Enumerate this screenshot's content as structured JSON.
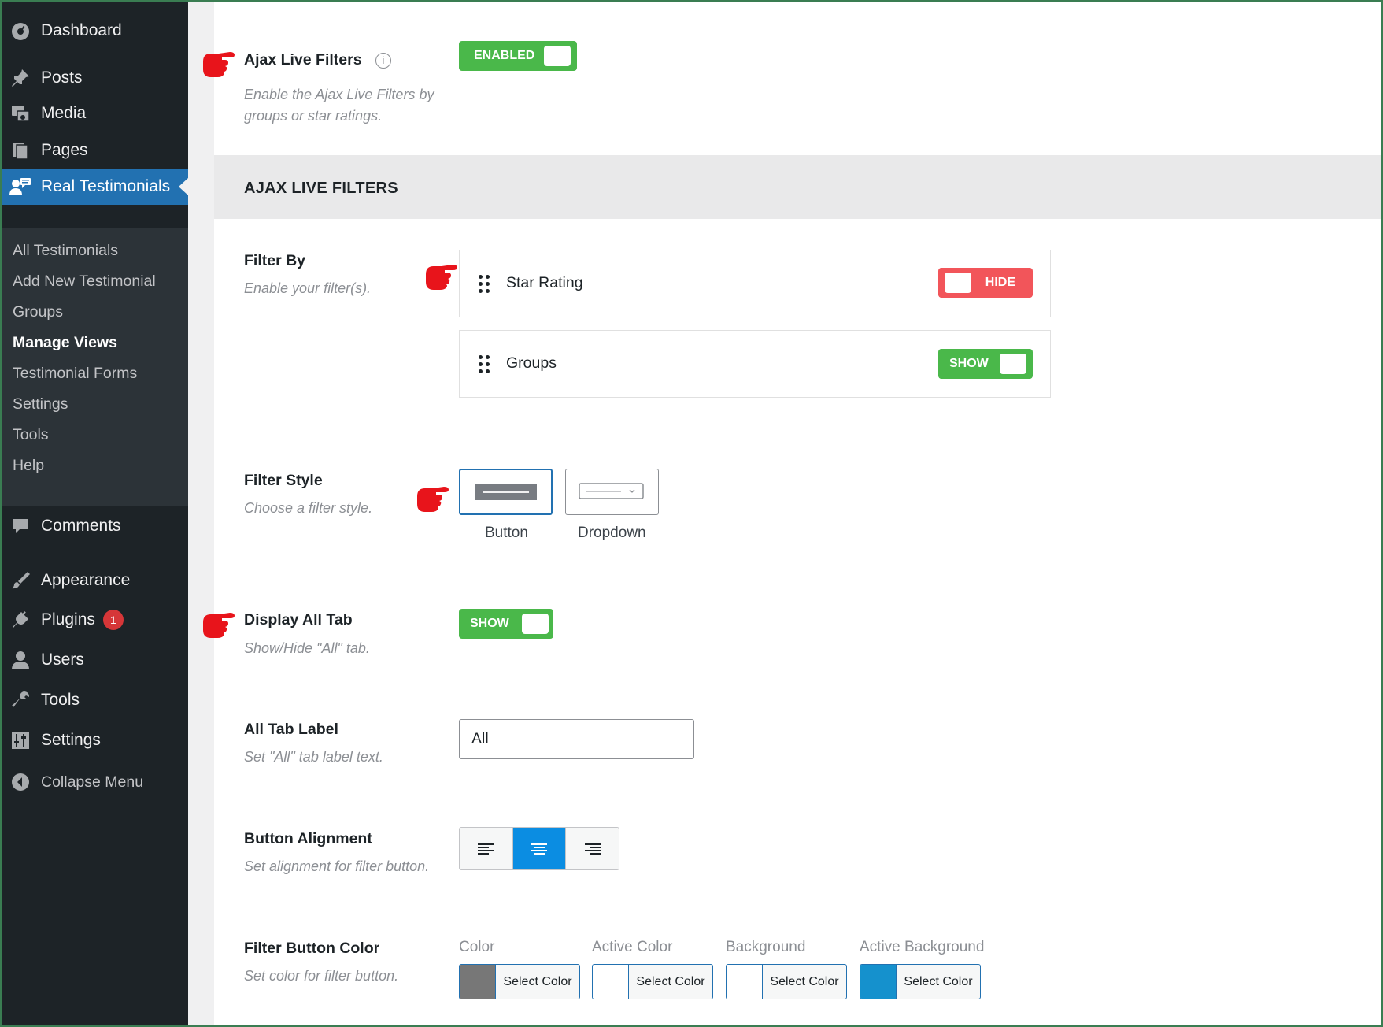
{
  "sidebar": {
    "menu": [
      {
        "label": "Dashboard",
        "icon": "dashboard-icon"
      },
      {
        "label": "Posts",
        "icon": "pin-icon"
      },
      {
        "label": "Media",
        "icon": "media-icon"
      },
      {
        "label": "Pages",
        "icon": "pages-icon"
      },
      {
        "label": "Real Testimonials",
        "icon": "testimonials-icon"
      },
      {
        "label": "Comments",
        "icon": "comment-icon"
      },
      {
        "label": "Appearance",
        "icon": "brush-icon"
      },
      {
        "label": "Plugins",
        "icon": "plugin-icon",
        "badge": "1"
      },
      {
        "label": "Users",
        "icon": "user-icon"
      },
      {
        "label": "Tools",
        "icon": "wrench-icon"
      },
      {
        "label": "Settings",
        "icon": "settings-icon"
      },
      {
        "label": "Collapse Menu",
        "icon": "collapse-icon"
      }
    ],
    "submenu": [
      "All Testimonials",
      "Add New Testimonial",
      "Groups",
      "Manage Views",
      "Testimonial Forms",
      "Settings",
      "Tools",
      "Help"
    ],
    "current_submenu": "Manage Views",
    "active_color": "#2271b1"
  },
  "ajax_filters": {
    "label": "Ajax Live Filters",
    "info_icon": "i",
    "description": "Enable the Ajax Live Filters by groups or star ratings.",
    "toggle_label": "ENABLED",
    "enabled": true
  },
  "section_title": "AJAX LIVE FILTERS",
  "filter_by": {
    "label": "Filter By",
    "description": "Enable your filter(s).",
    "items": [
      {
        "name": "Star Rating",
        "toggle": "HIDE",
        "enabled": false
      },
      {
        "name": "Groups",
        "toggle": "SHOW",
        "enabled": true
      }
    ]
  },
  "filter_style": {
    "label": "Filter Style",
    "description": "Choose a filter style.",
    "options": [
      "Button",
      "Dropdown"
    ],
    "selected": "Button"
  },
  "display_all_tab": {
    "label": "Display All Tab",
    "description": "Show/Hide \"All\" tab.",
    "toggle_label": "SHOW",
    "enabled": true
  },
  "all_tab_label": {
    "label": "All Tab Label",
    "description": "Set \"All\" tab label text.",
    "value": "All"
  },
  "button_alignment": {
    "label": "Button Alignment",
    "description": "Set alignment for filter button.",
    "options": [
      "left",
      "center",
      "right"
    ],
    "selected": "center"
  },
  "filter_button_color": {
    "label": "Filter Button Color",
    "description": "Set color for filter button.",
    "pickers": [
      {
        "label": "Color",
        "button": "Select Color",
        "value": "#777777"
      },
      {
        "label": "Active Color",
        "button": "Select Color",
        "value": "#ffffff"
      },
      {
        "label": "Background",
        "button": "Select Color",
        "value": "#ffffff"
      },
      {
        "label": "Active Background",
        "button": "Select Color",
        "value": "#1591cd"
      }
    ]
  },
  "colors": {
    "toggle_on": "#4ab84a",
    "toggle_off": "#f2555a",
    "pointer": "#e8141b"
  }
}
